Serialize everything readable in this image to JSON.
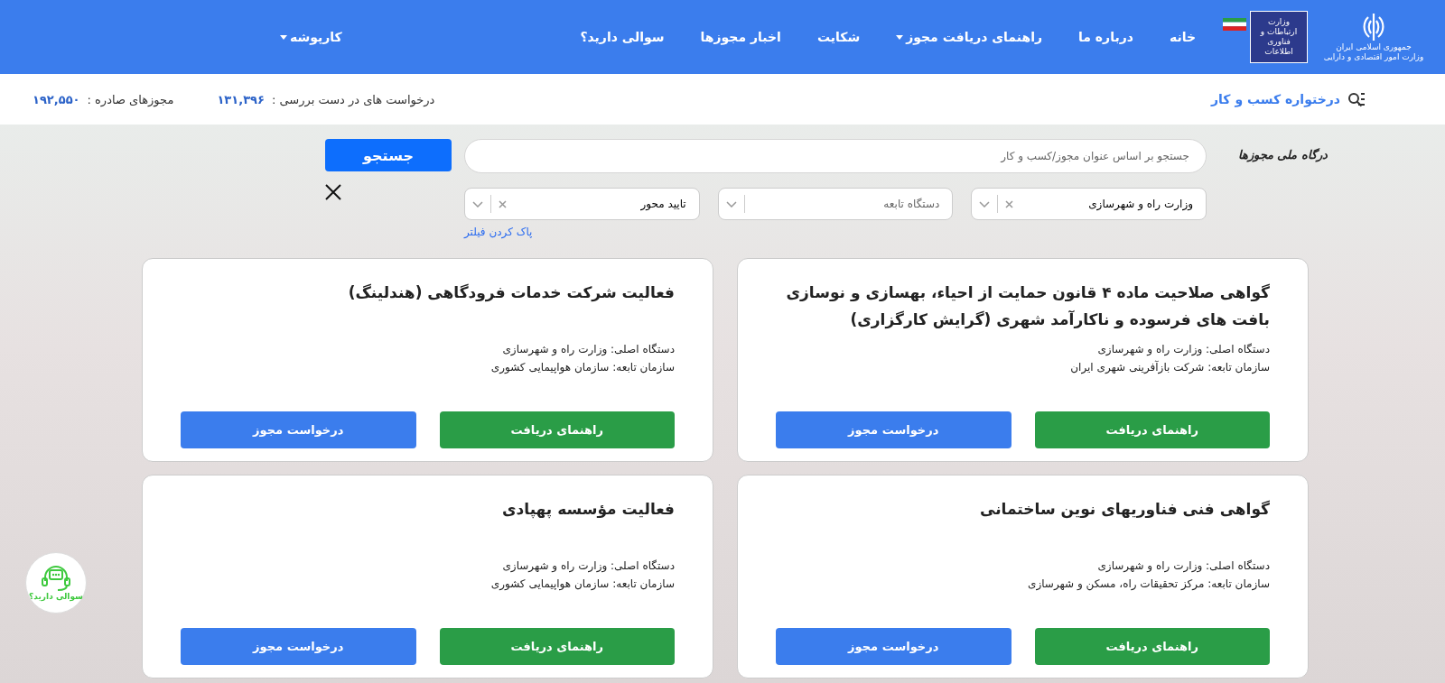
{
  "header": {
    "emblem_text": [
      "جمهوری اسلامی ایران",
      "وزارت امور اقتصادی و دارایی"
    ],
    "ministry_logo_text": "وزارت ارتباطات و فناوری اطلاعات",
    "nav": [
      {
        "label": "خانه",
        "dropdown": false
      },
      {
        "label": "درباره ما",
        "dropdown": false
      },
      {
        "label": "راهنمای دریافت مجوز",
        "dropdown": true
      },
      {
        "label": "شکایت",
        "dropdown": false
      },
      {
        "label": "اخبار مجوزها",
        "dropdown": false
      },
      {
        "label": "سوالی دارید؟",
        "dropdown": false
      }
    ],
    "user_menu": {
      "label": "کارپوشه",
      "dropdown": true
    }
  },
  "stats_bar": {
    "tree_link": "درختواره کسب و کار",
    "stats": [
      {
        "label": "درخواست های در دست بررسی :",
        "value": "۱۳۱,۳۹۶"
      },
      {
        "label": "مجوزهای صادره :",
        "value": "۱۹۲,۵۵۰"
      }
    ]
  },
  "search": {
    "logo_text": "درگاه ملی مجوزها",
    "placeholder": "جستجو بر اساس عنوان مجوز/کسب و کار",
    "button": "جستجو",
    "filters": [
      {
        "value": "وزارت راه و شهرسازی",
        "clearable": true
      },
      {
        "placeholder": "دستگاه تابعه",
        "clearable": false
      },
      {
        "value": "تایید محور",
        "clearable": true
      }
    ],
    "clear_filters": "پاک کردن فیلتر"
  },
  "cards": [
    {
      "title": "گواهی صلاحیت ماده ۴ قانون حمایت از احیاء، بهسازی و نوسازی بافت های فرسوده و ناکارآمد شهری (گرایش کارگزاری)",
      "main_org": "دستگاه اصلی: وزارت راه و شهرسازی",
      "sub_org": "سازمان تابعه: شرکت بازآفرینی شهری ایران",
      "guide_button": "راهنمای دریافت",
      "request_button": "درخواست مجوز"
    },
    {
      "title": "فعالیت شرکت خدمات فرودگاهی (هندلینگ)",
      "main_org": "دستگاه اصلی: وزارت راه و شهرسازی",
      "sub_org": "سازمان تابعه: سازمان هواپیمایی کشوری",
      "guide_button": "راهنمای دریافت",
      "request_button": "درخواست مجوز"
    },
    {
      "title": "گواهی فنی فناوریهای نوین ساختمانی",
      "main_org": "دستگاه اصلی: وزارت راه و شهرسازی",
      "sub_org": "سازمان تابعه: مرکز تحقیقات راه، مسکن و شهرسازی",
      "guide_button": "راهنمای دریافت",
      "request_button": "درخواست مجوز"
    },
    {
      "title": "فعالیت مؤسسه پهپادی",
      "main_org": "دستگاه اصلی: وزارت راه و شهرسازی",
      "sub_org": "سازمان تابعه: سازمان هواپیمایی کشوری",
      "guide_button": "راهنمای دریافت",
      "request_button": "درخواست مجوز"
    }
  ],
  "support_widget": {
    "label": "سوالی دارید؟"
  }
}
